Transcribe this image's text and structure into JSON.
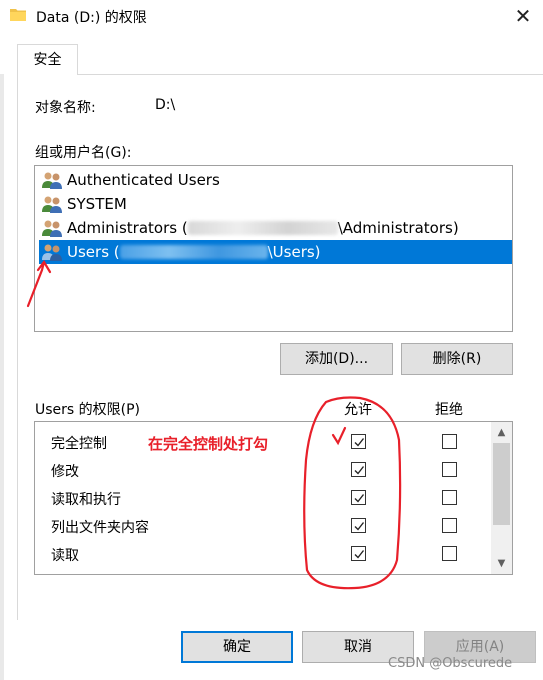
{
  "window": {
    "title": "Data (D:) 的权限",
    "close_glyph": "✕"
  },
  "tabs": [
    {
      "label": "安全",
      "active": true
    }
  ],
  "object": {
    "label": "对象名称:",
    "value": "D:\\"
  },
  "groups": {
    "label": "组或用户名(G):",
    "items": [
      {
        "prefix": "Authenticated Users",
        "suffix": "",
        "redacted": false,
        "selected": false,
        "icon": "users-group-icon"
      },
      {
        "prefix": "SYSTEM",
        "suffix": "",
        "redacted": false,
        "selected": false,
        "icon": "users-group-icon"
      },
      {
        "prefix": "Administrators (",
        "suffix": "\\Administrators)",
        "redacted": true,
        "selected": false,
        "icon": "users-group-icon"
      },
      {
        "prefix": "Users (",
        "suffix": "\\Users)",
        "redacted": true,
        "selected": true,
        "icon": "users-group-icon"
      }
    ]
  },
  "buttons": {
    "add": "添加(D)...",
    "remove": "删除(R)",
    "ok": "确定",
    "cancel": "取消",
    "apply": "应用(A)"
  },
  "permissions": {
    "label": "Users 的权限(P)",
    "allow_header": "允许",
    "deny_header": "拒绝",
    "rows": [
      {
        "name": "完全控制",
        "allow": true,
        "deny": false
      },
      {
        "name": "修改",
        "allow": true,
        "deny": false
      },
      {
        "name": "读取和执行",
        "allow": true,
        "deny": false
      },
      {
        "name": "列出文件夹内容",
        "allow": true,
        "deny": false
      },
      {
        "name": "读取",
        "allow": true,
        "deny": false
      }
    ]
  },
  "annotation": {
    "text": "在完全控制处打勾",
    "color": "#e8202a"
  },
  "watermark": "CSDN @Obscurede",
  "colors": {
    "selection": "#0078d7",
    "button_face": "#e1e1e1",
    "annotation_red": "#e8202a"
  }
}
